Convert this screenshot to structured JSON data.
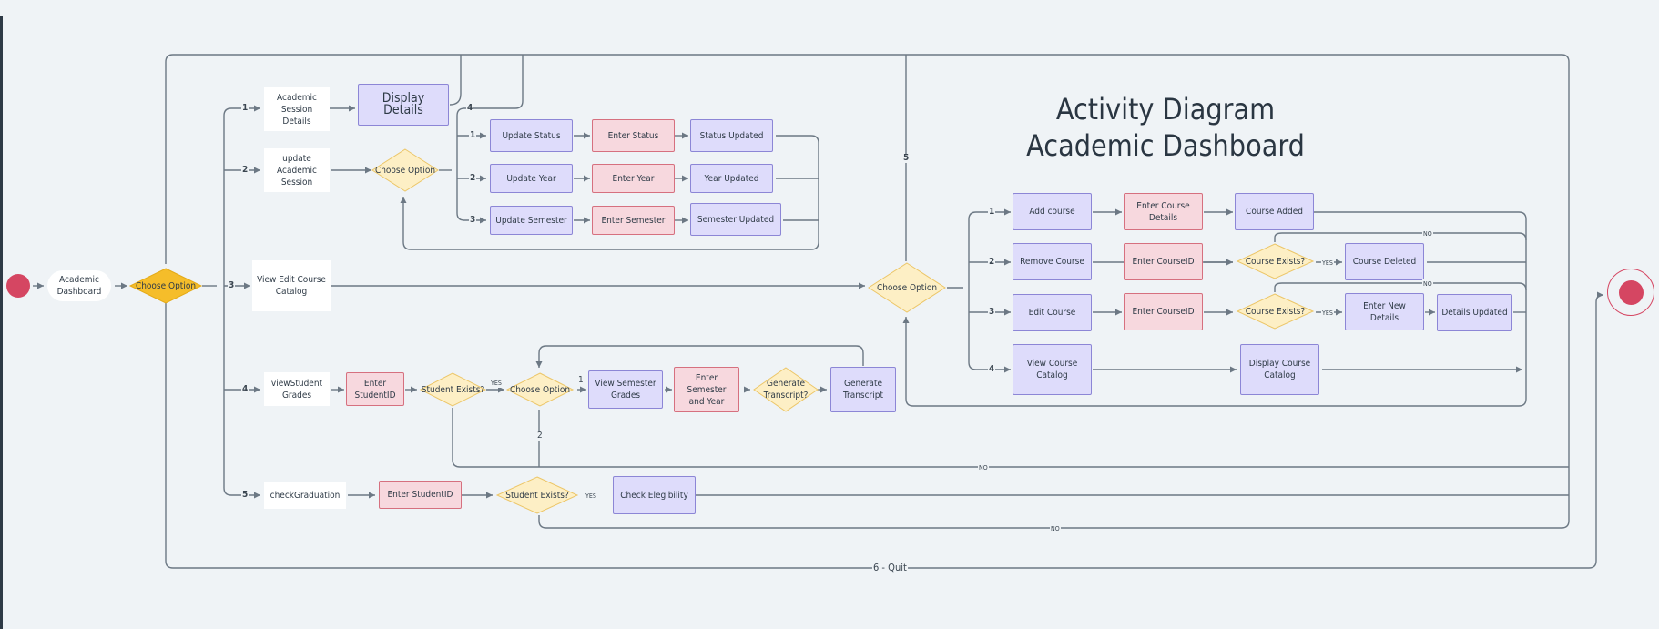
{
  "diagram": {
    "title_line1": "Activity Diagram",
    "title_line2": "Academic Dashboard",
    "colors": {
      "background": "#eff3f6",
      "action_purple": "#dedcfb",
      "input_pink": "#f7d8de",
      "decision_yellow": "#fdefc5",
      "main_decision": "#f5bd2a",
      "start_end": "#d54662",
      "connector": "#6c7884"
    },
    "start": {
      "name": "start-node"
    },
    "main": {
      "dashboard": "Academic Dashboard",
      "choose": "Choose Option"
    },
    "options": {
      "o1": {
        "num": "1",
        "label": "Academic Session Details",
        "display": "Display Details"
      },
      "o2": {
        "num": "2",
        "label": "update Academic Session",
        "choose": "Choose Option",
        "branches": [
          {
            "num": "1",
            "action": "Update Status",
            "input": "Enter Status",
            "result": "Status Updated"
          },
          {
            "num": "2",
            "action": "Update Year",
            "input": "Enter Year",
            "result": "Year Updated"
          },
          {
            "num": "3",
            "action": "Update Semester",
            "input": "Enter Semester",
            "result": "Semester Updated"
          }
        ],
        "back_num": "4"
      },
      "o3": {
        "num": "3",
        "label": "View Edit Course Catalog",
        "choose": "Choose Option",
        "back_num": "5",
        "add": {
          "num": "1",
          "action": "Add course",
          "input": "Enter Course Details",
          "result": "Course Added"
        },
        "remove": {
          "num": "2",
          "action": "Remove Course",
          "input": "Enter CourseID",
          "check": "Course Exists?",
          "yes": "YES",
          "no": "NO",
          "result": "Course Deleted"
        },
        "edit": {
          "num": "3",
          "action": "Edit Course",
          "input": "Enter CourseID",
          "check": "Course Exists?",
          "yes": "YES",
          "no": "NO",
          "details": "Enter New Details",
          "result": "Details Updated"
        },
        "view": {
          "num": "4",
          "action": "View Course Catalog",
          "result": "Display Course Catalog"
        }
      },
      "o4": {
        "num": "4",
        "label": "viewStudent Grades",
        "input": "Enter StudentID",
        "check": "Student Exists?",
        "yes": "YES",
        "no": "NO",
        "choose": "Choose Option",
        "opt1": "1",
        "opt2": "2",
        "view": "View Semester Grades",
        "input2": "Enter Semester and Year",
        "gen_q": "Generate Transcript?",
        "gen": "Generate Transcript"
      },
      "o5": {
        "num": "5",
        "label": "checkGraduation",
        "input": "Enter StudentID",
        "check": "Student Exists?",
        "yes": "YES",
        "no": "NO",
        "result": "Check Elegibility"
      },
      "quit": "6 - Quit"
    },
    "end": {
      "name": "end-node"
    }
  }
}
